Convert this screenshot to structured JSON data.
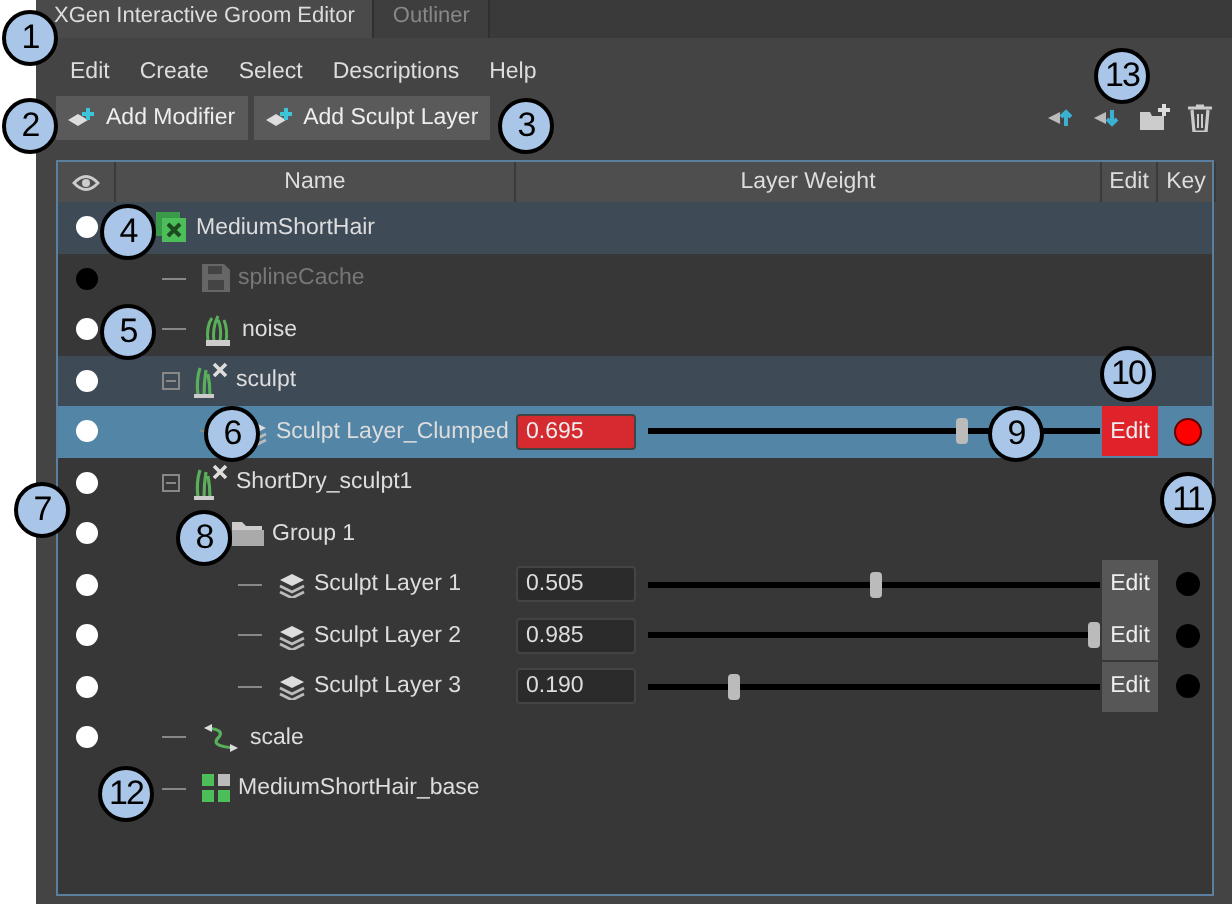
{
  "tabs": [
    {
      "label": "XGen Interactive Groom Editor",
      "selected": true
    },
    {
      "label": "Outliner",
      "selected": false
    }
  ],
  "menu": [
    "Edit",
    "Create",
    "Select",
    "Descriptions",
    "Help"
  ],
  "toolbar": {
    "buttons": [
      "Add Modifier",
      "Add Sculpt Layer"
    ]
  },
  "table": {
    "columns": [
      "Name",
      "Layer Weight",
      "Edit",
      "Key"
    ],
    "rows": [
      {
        "name": "MediumShortHair",
        "kind": "description",
        "visible": true,
        "highlighted": true,
        "selected": false,
        "disabled": false,
        "children": [
          {
            "name": "splineCache",
            "kind": "cache",
            "visible": false,
            "highlighted": false,
            "selected": false,
            "disabled": true
          },
          {
            "name": "noise",
            "kind": "noise",
            "visible": true,
            "highlighted": false,
            "selected": false,
            "disabled": false
          },
          {
            "name": "sculpt",
            "kind": "sculpt",
            "visible": true,
            "highlighted": true,
            "selected": false,
            "disabled": false,
            "expanded": true,
            "children": [
              {
                "name": "Sculpt Layer_Clumped",
                "kind": "layer",
                "visible": true,
                "selected": true,
                "disabled": false,
                "weight": "0.695",
                "level": 0.695,
                "edit_label": "Edit",
                "edit_active": true,
                "keyed": true
              }
            ]
          },
          {
            "name": "ShortDry_sculpt1",
            "kind": "sculpt",
            "visible": true,
            "highlighted": false,
            "selected": false,
            "disabled": false,
            "expanded": true,
            "children": [
              {
                "name": "Group 1",
                "kind": "group",
                "visible": true,
                "highlighted": false,
                "selected": false,
                "disabled": false,
                "children": [
                  {
                    "name": "Sculpt Layer 1",
                    "kind": "layer",
                    "visible": true,
                    "highlighted": false,
                    "selected": false,
                    "disabled": false,
                    "weight": "0.505",
                    "level": 0.505,
                    "edit_label": "Edit",
                    "edit_active": false,
                    "keyed": false
                  },
                  {
                    "name": "Sculpt Layer 2",
                    "kind": "layer",
                    "visible": true,
                    "highlighted": false,
                    "selected": false,
                    "disabled": false,
                    "weight": "0.985",
                    "level": 0.985,
                    "edit_label": "Edit",
                    "edit_active": false,
                    "keyed": false
                  },
                  {
                    "name": "Sculpt Layer 3",
                    "kind": "layer",
                    "visible": true,
                    "highlighted": false,
                    "selected": false,
                    "disabled": false,
                    "weight": "0.190",
                    "level": 0.19,
                    "edit_label": "Edit",
                    "edit_active": false,
                    "keyed": false
                  }
                ]
              }
            ]
          },
          {
            "name": "scale",
            "kind": "scale",
            "visible": true,
            "highlighted": false,
            "selected": false,
            "disabled": false
          },
          {
            "name": "MediumShortHair_base",
            "kind": "base",
            "highlighted": false,
            "selected": false,
            "disabled": false
          }
        ]
      }
    ]
  },
  "callouts": [
    "1",
    "2",
    "3",
    "4",
    "5",
    "6",
    "7",
    "8",
    "9",
    "10",
    "11",
    "12",
    "13"
  ]
}
